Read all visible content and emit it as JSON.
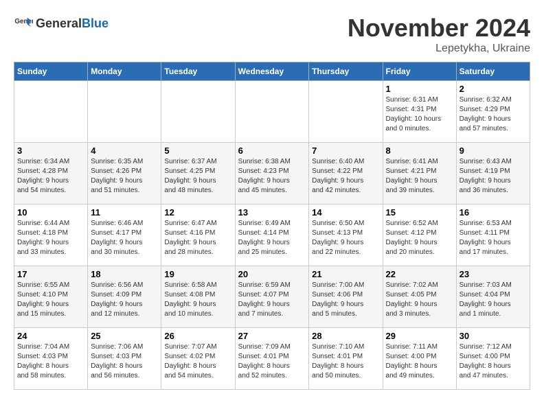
{
  "logo": {
    "general": "General",
    "blue": "Blue"
  },
  "header": {
    "month_year": "November 2024",
    "location": "Lepetykha, Ukraine"
  },
  "weekdays": [
    "Sunday",
    "Monday",
    "Tuesday",
    "Wednesday",
    "Thursday",
    "Friday",
    "Saturday"
  ],
  "weeks": [
    [
      {
        "day": "",
        "info": ""
      },
      {
        "day": "",
        "info": ""
      },
      {
        "day": "",
        "info": ""
      },
      {
        "day": "",
        "info": ""
      },
      {
        "day": "",
        "info": ""
      },
      {
        "day": "1",
        "info": "Sunrise: 6:31 AM\nSunset: 4:31 PM\nDaylight: 10 hours\nand 0 minutes."
      },
      {
        "day": "2",
        "info": "Sunrise: 6:32 AM\nSunset: 4:29 PM\nDaylight: 9 hours\nand 57 minutes."
      }
    ],
    [
      {
        "day": "3",
        "info": "Sunrise: 6:34 AM\nSunset: 4:28 PM\nDaylight: 9 hours\nand 54 minutes."
      },
      {
        "day": "4",
        "info": "Sunrise: 6:35 AM\nSunset: 4:26 PM\nDaylight: 9 hours\nand 51 minutes."
      },
      {
        "day": "5",
        "info": "Sunrise: 6:37 AM\nSunset: 4:25 PM\nDaylight: 9 hours\nand 48 minutes."
      },
      {
        "day": "6",
        "info": "Sunrise: 6:38 AM\nSunset: 4:23 PM\nDaylight: 9 hours\nand 45 minutes."
      },
      {
        "day": "7",
        "info": "Sunrise: 6:40 AM\nSunset: 4:22 PM\nDaylight: 9 hours\nand 42 minutes."
      },
      {
        "day": "8",
        "info": "Sunrise: 6:41 AM\nSunset: 4:21 PM\nDaylight: 9 hours\nand 39 minutes."
      },
      {
        "day": "9",
        "info": "Sunrise: 6:43 AM\nSunset: 4:19 PM\nDaylight: 9 hours\nand 36 minutes."
      }
    ],
    [
      {
        "day": "10",
        "info": "Sunrise: 6:44 AM\nSunset: 4:18 PM\nDaylight: 9 hours\nand 33 minutes."
      },
      {
        "day": "11",
        "info": "Sunrise: 6:46 AM\nSunset: 4:17 PM\nDaylight: 9 hours\nand 30 minutes."
      },
      {
        "day": "12",
        "info": "Sunrise: 6:47 AM\nSunset: 4:16 PM\nDaylight: 9 hours\nand 28 minutes."
      },
      {
        "day": "13",
        "info": "Sunrise: 6:49 AM\nSunset: 4:14 PM\nDaylight: 9 hours\nand 25 minutes."
      },
      {
        "day": "14",
        "info": "Sunrise: 6:50 AM\nSunset: 4:13 PM\nDaylight: 9 hours\nand 22 minutes."
      },
      {
        "day": "15",
        "info": "Sunrise: 6:52 AM\nSunset: 4:12 PM\nDaylight: 9 hours\nand 20 minutes."
      },
      {
        "day": "16",
        "info": "Sunrise: 6:53 AM\nSunset: 4:11 PM\nDaylight: 9 hours\nand 17 minutes."
      }
    ],
    [
      {
        "day": "17",
        "info": "Sunrise: 6:55 AM\nSunset: 4:10 PM\nDaylight: 9 hours\nand 15 minutes."
      },
      {
        "day": "18",
        "info": "Sunrise: 6:56 AM\nSunset: 4:09 PM\nDaylight: 9 hours\nand 12 minutes."
      },
      {
        "day": "19",
        "info": "Sunrise: 6:58 AM\nSunset: 4:08 PM\nDaylight: 9 hours\nand 10 minutes."
      },
      {
        "day": "20",
        "info": "Sunrise: 6:59 AM\nSunset: 4:07 PM\nDaylight: 9 hours\nand 7 minutes."
      },
      {
        "day": "21",
        "info": "Sunrise: 7:00 AM\nSunset: 4:06 PM\nDaylight: 9 hours\nand 5 minutes."
      },
      {
        "day": "22",
        "info": "Sunrise: 7:02 AM\nSunset: 4:05 PM\nDaylight: 9 hours\nand 3 minutes."
      },
      {
        "day": "23",
        "info": "Sunrise: 7:03 AM\nSunset: 4:04 PM\nDaylight: 9 hours\nand 1 minute."
      }
    ],
    [
      {
        "day": "24",
        "info": "Sunrise: 7:04 AM\nSunset: 4:03 PM\nDaylight: 8 hours\nand 58 minutes."
      },
      {
        "day": "25",
        "info": "Sunrise: 7:06 AM\nSunset: 4:03 PM\nDaylight: 8 hours\nand 56 minutes."
      },
      {
        "day": "26",
        "info": "Sunrise: 7:07 AM\nSunset: 4:02 PM\nDaylight: 8 hours\nand 54 minutes."
      },
      {
        "day": "27",
        "info": "Sunrise: 7:09 AM\nSunset: 4:01 PM\nDaylight: 8 hours\nand 52 minutes."
      },
      {
        "day": "28",
        "info": "Sunrise: 7:10 AM\nSunset: 4:01 PM\nDaylight: 8 hours\nand 50 minutes."
      },
      {
        "day": "29",
        "info": "Sunrise: 7:11 AM\nSunset: 4:00 PM\nDaylight: 8 hours\nand 49 minutes."
      },
      {
        "day": "30",
        "info": "Sunrise: 7:12 AM\nSunset: 4:00 PM\nDaylight: 8 hours\nand 47 minutes."
      }
    ]
  ]
}
